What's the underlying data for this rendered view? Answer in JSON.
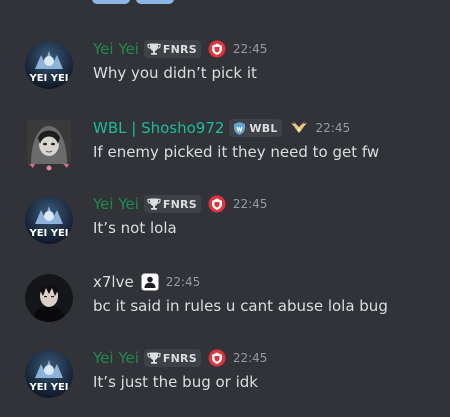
{
  "channel": {
    "messages": [
      {
        "username": "Yei Yei",
        "username_color": "#1f8b4c",
        "tag": "FNRS",
        "tag_icon": "trophy-icon",
        "role_icon": "red-emblem-icon",
        "timestamp": "22:45",
        "content": "Why you didn’t pick it",
        "avatar_text": "YEI YEI"
      },
      {
        "username": "WBL | Shosho972",
        "username_color": "#1abc9c",
        "tag": "WBL",
        "tag_icon": "shield-icon",
        "role_icon": "wings-icon",
        "timestamp": "22:45",
        "content": "If enemy picked it they need to get fw"
      },
      {
        "username": "Yei Yei",
        "username_color": "#1f8b4c",
        "tag": "FNRS",
        "tag_icon": "trophy-icon",
        "role_icon": "red-emblem-icon",
        "timestamp": "22:45",
        "content": "It’s not lola",
        "avatar_text": "YEI YEI"
      },
      {
        "username": "x7lve",
        "username_color": "#dbdee1",
        "role_icon": "person-icon",
        "timestamp": "22:45",
        "content": "bc it said in rules u cant abuse lola bug"
      },
      {
        "username": "Yei Yei",
        "username_color": "#1f8b4c",
        "tag": "FNRS",
        "tag_icon": "trophy-icon",
        "role_icon": "red-emblem-icon",
        "timestamp": "22:45",
        "content": "It’s just the bug or idk",
        "avatar_text": "YEI YEI"
      }
    ]
  }
}
